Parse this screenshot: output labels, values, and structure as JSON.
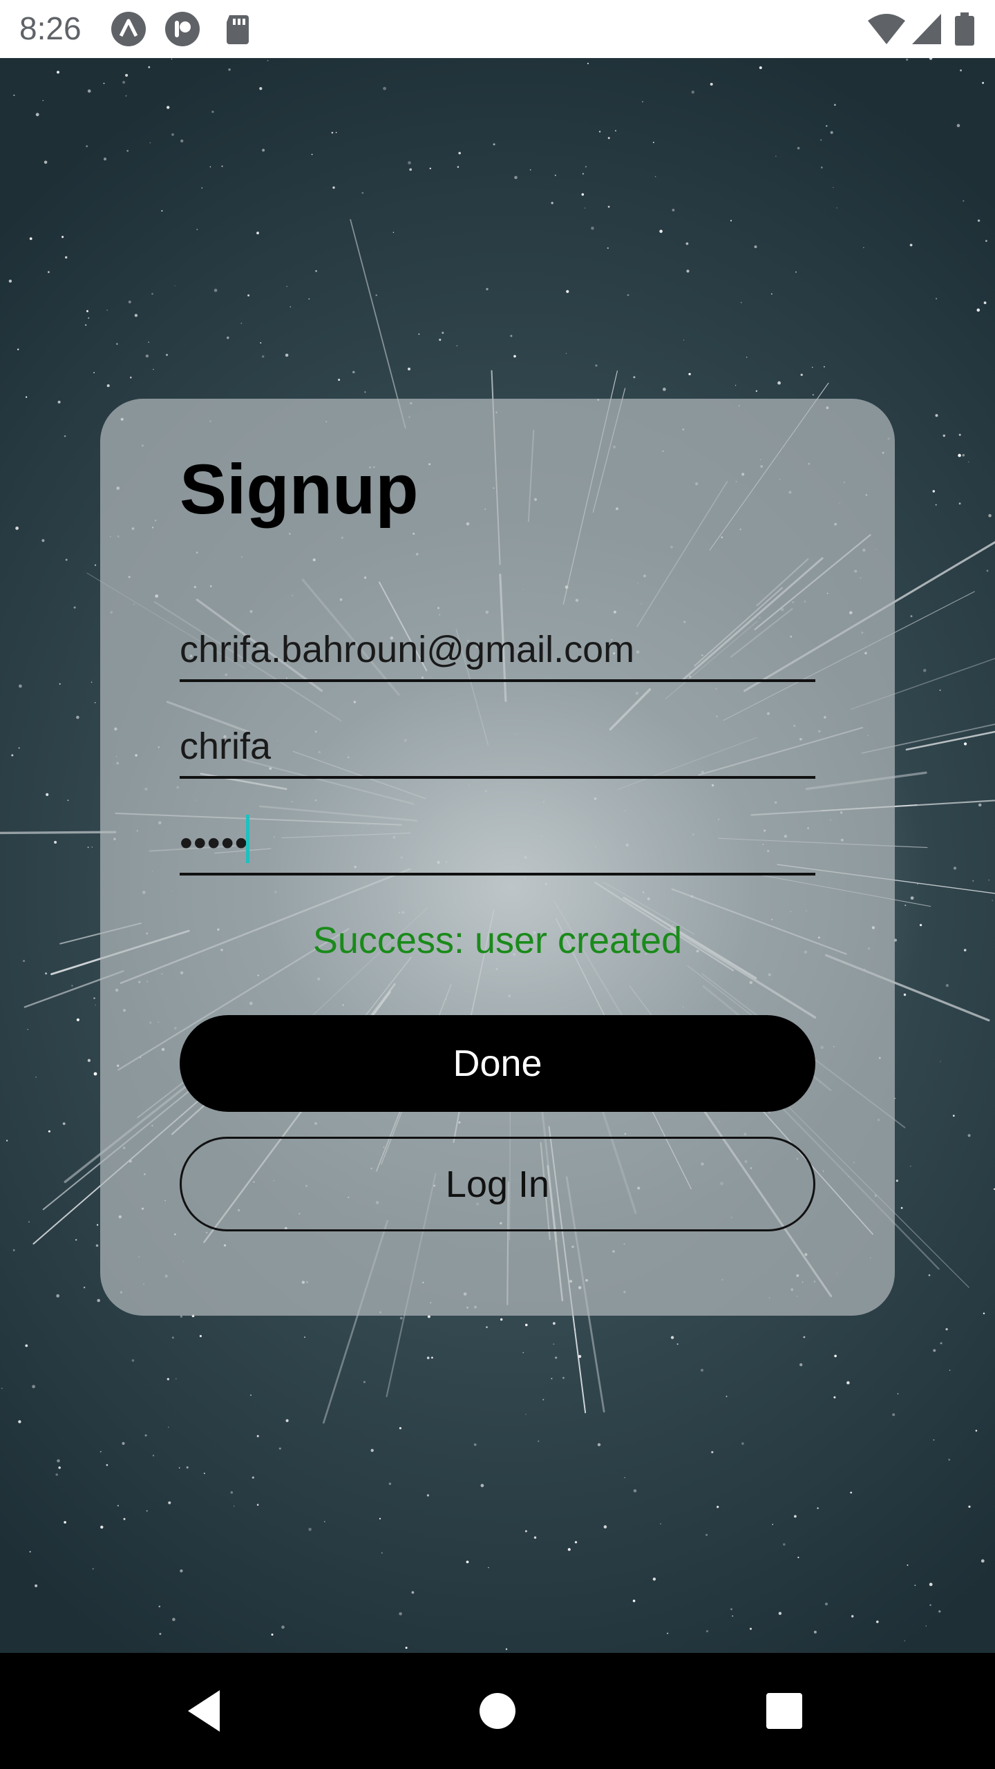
{
  "status_bar": {
    "time": "8:26",
    "icons": [
      "app-a-icon",
      "app-p-icon",
      "sd-card-icon",
      "wifi-icon",
      "signal-icon",
      "battery-icon"
    ]
  },
  "form": {
    "title": "Signup",
    "email_value": "chrifa.bahrouni@gmail.com",
    "username_value": "chrifa",
    "password_masked": "•••••",
    "status_message": "Success: user created",
    "done_label": "Done",
    "login_label": "Log In"
  },
  "colors": {
    "success": "#1a8a1a",
    "cursor": "#1fc0c0",
    "primary_button": "#000000"
  },
  "nav_bar": {
    "buttons": [
      "back-icon",
      "home-icon",
      "recents-icon"
    ]
  }
}
